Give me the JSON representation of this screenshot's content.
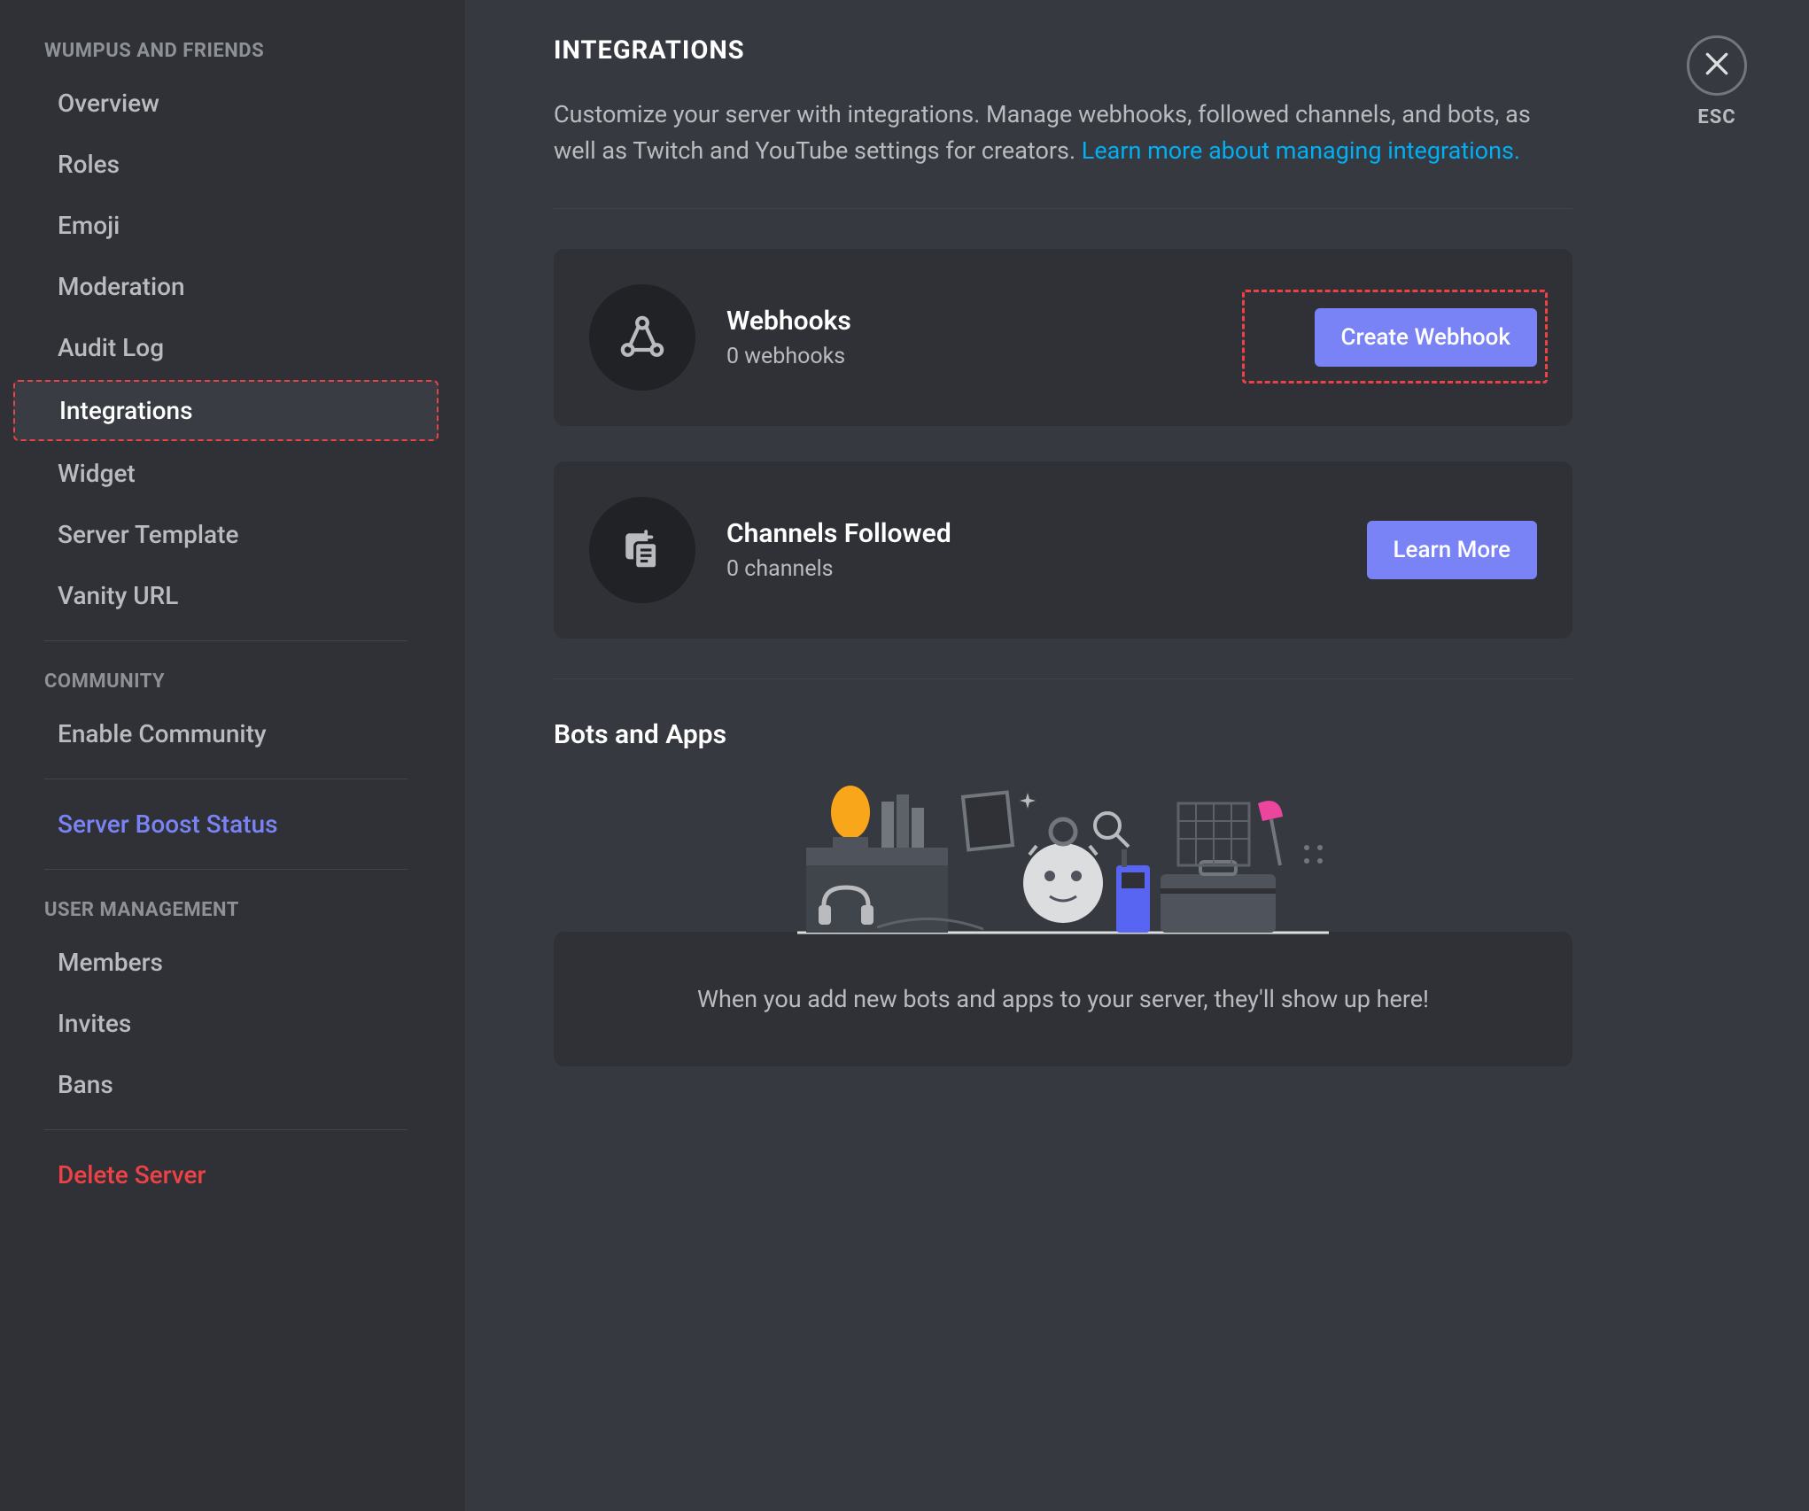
{
  "sidebar": {
    "group1_label": "WUMPUS AND FRIENDS",
    "items1": [
      {
        "label": "Overview"
      },
      {
        "label": "Roles"
      },
      {
        "label": "Emoji"
      },
      {
        "label": "Moderation"
      },
      {
        "label": "Audit Log"
      },
      {
        "label": "Integrations"
      },
      {
        "label": "Widget"
      },
      {
        "label": "Server Template"
      },
      {
        "label": "Vanity URL"
      }
    ],
    "group2_label": "COMMUNITY",
    "items2": [
      {
        "label": "Enable Community"
      }
    ],
    "boost_label": "Server Boost Status",
    "group3_label": "USER MANAGEMENT",
    "items3": [
      {
        "label": "Members"
      },
      {
        "label": "Invites"
      },
      {
        "label": "Bans"
      }
    ],
    "delete_label": "Delete Server"
  },
  "close": {
    "label": "ESC"
  },
  "page": {
    "title": "INTEGRATIONS",
    "description_prefix": "Customize your server with integrations. Manage webhooks, followed channels, and bots, as well as Twitch and YouTube settings for creators. ",
    "learn_more_link": "Learn more about managing integrations."
  },
  "webhooks_card": {
    "title": "Webhooks",
    "subtitle": "0 webhooks",
    "button": "Create Webhook"
  },
  "channels_card": {
    "title": "Channels Followed",
    "subtitle": "0 channels",
    "button": "Learn More"
  },
  "bots_section": {
    "heading": "Bots and Apps",
    "empty_text": "When you add new bots and apps to your server, they'll show up here!"
  }
}
